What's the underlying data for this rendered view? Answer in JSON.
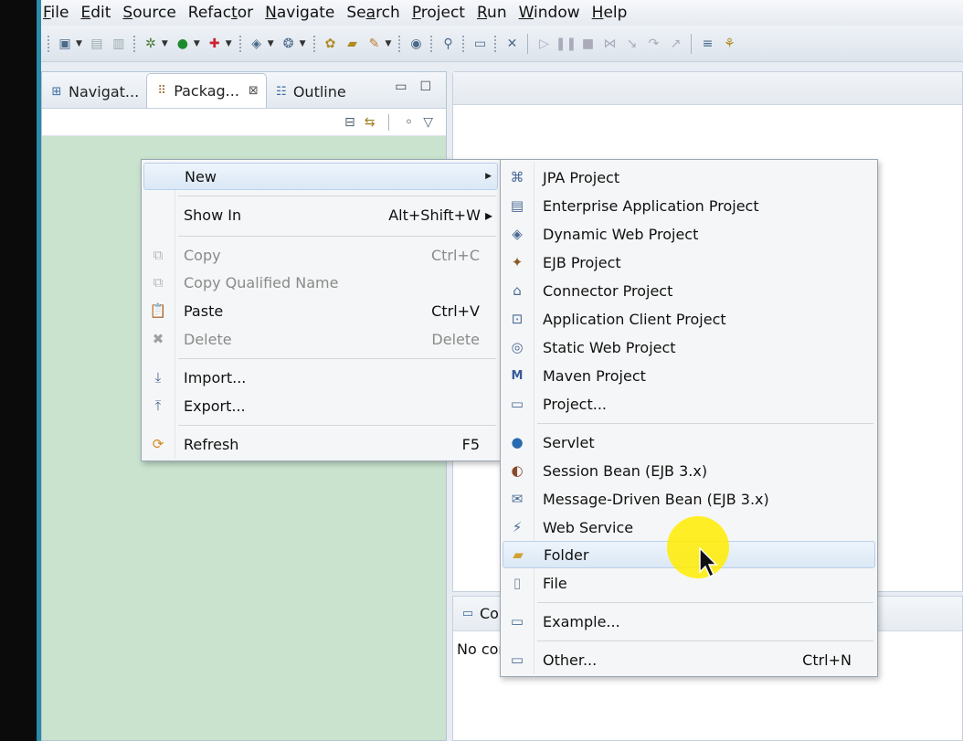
{
  "menubar": {
    "items": [
      {
        "label": "File",
        "mnemonic": "F",
        "rest": "ile"
      },
      {
        "label": "Edit",
        "mnemonic": "E",
        "rest": "dit"
      },
      {
        "label": "Source",
        "mnemonic": "S",
        "rest": "ource"
      },
      {
        "label": "Refactor",
        "pre": "Refac",
        "mnemonic": "t",
        "rest": "or"
      },
      {
        "label": "Navigate",
        "mnemonic": "N",
        "rest": "avigate"
      },
      {
        "label": "Search",
        "pre": "Se",
        "mnemonic": "a",
        "rest": "rch"
      },
      {
        "label": "Project",
        "mnemonic": "P",
        "rest": "roject"
      },
      {
        "label": "Run",
        "mnemonic": "R",
        "rest": "un"
      },
      {
        "label": "Window",
        "mnemonic": "W",
        "rest": "indow"
      },
      {
        "label": "Help",
        "mnemonic": "H",
        "rest": "elp"
      }
    ]
  },
  "views": {
    "tabs": [
      {
        "label": "Navigat...",
        "icon": "navigator-icon"
      },
      {
        "label": "Packag...",
        "icon": "package-explorer-icon",
        "close": "⊠"
      },
      {
        "label": "Outline",
        "icon": "outline-icon"
      }
    ],
    "minimize": "▭",
    "maximize": "☐"
  },
  "console": {
    "tab_label": "Consol",
    "body_text": "No consol"
  },
  "context_menu": {
    "items": [
      {
        "label": "New",
        "arrow": "▶"
      },
      {
        "label": "Show In",
        "shortcut": "Alt+Shift+W ▸"
      },
      {
        "label": "Copy",
        "shortcut": "Ctrl+C",
        "icon": "copy-icon"
      },
      {
        "label": "Copy Qualified Name",
        "icon": "copy-qualified-name-icon"
      },
      {
        "label": "Paste",
        "shortcut": "Ctrl+V",
        "icon": "paste-icon"
      },
      {
        "label": "Delete",
        "shortcut": "Delete",
        "icon": "delete-icon"
      },
      {
        "label": "Import...",
        "icon": "import-icon"
      },
      {
        "label": "Export...",
        "icon": "export-icon"
      },
      {
        "label": "Refresh",
        "shortcut": "F5",
        "icon": "refresh-icon"
      }
    ]
  },
  "new_submenu": {
    "items": [
      {
        "label": "JPA Project",
        "icon": "jpa-project-icon"
      },
      {
        "label": "Enterprise Application Project",
        "icon": "enterprise-app-project-icon"
      },
      {
        "label": "Dynamic Web Project",
        "icon": "dynamic-web-project-icon"
      },
      {
        "label": "EJB Project",
        "icon": "ejb-project-icon"
      },
      {
        "label": "Connector Project",
        "icon": "connector-project-icon"
      },
      {
        "label": "Application Client Project",
        "icon": "app-client-project-icon"
      },
      {
        "label": "Static Web Project",
        "icon": "static-web-project-icon"
      },
      {
        "label": "Maven Project",
        "icon": "maven-project-icon"
      },
      {
        "label": "Project...",
        "icon": "project-icon"
      },
      {
        "label": "Servlet",
        "icon": "servlet-icon"
      },
      {
        "label": "Session Bean (EJB 3.x)",
        "icon": "session-bean-icon"
      },
      {
        "label": "Message-Driven Bean (EJB 3.x)",
        "icon": "message-driven-bean-icon"
      },
      {
        "label": "Web Service",
        "icon": "web-service-icon"
      },
      {
        "label": "Folder",
        "icon": "folder-icon"
      },
      {
        "label": "File",
        "icon": "file-icon"
      },
      {
        "label": "Example...",
        "icon": "example-icon"
      },
      {
        "label": "Other...",
        "shortcut": "Ctrl+N",
        "icon": "other-icon"
      }
    ]
  },
  "colors": {
    "panel_bg": "#c9e3cf",
    "highlight": "#dbe8f6",
    "cursor_halo": "#ffec00"
  }
}
